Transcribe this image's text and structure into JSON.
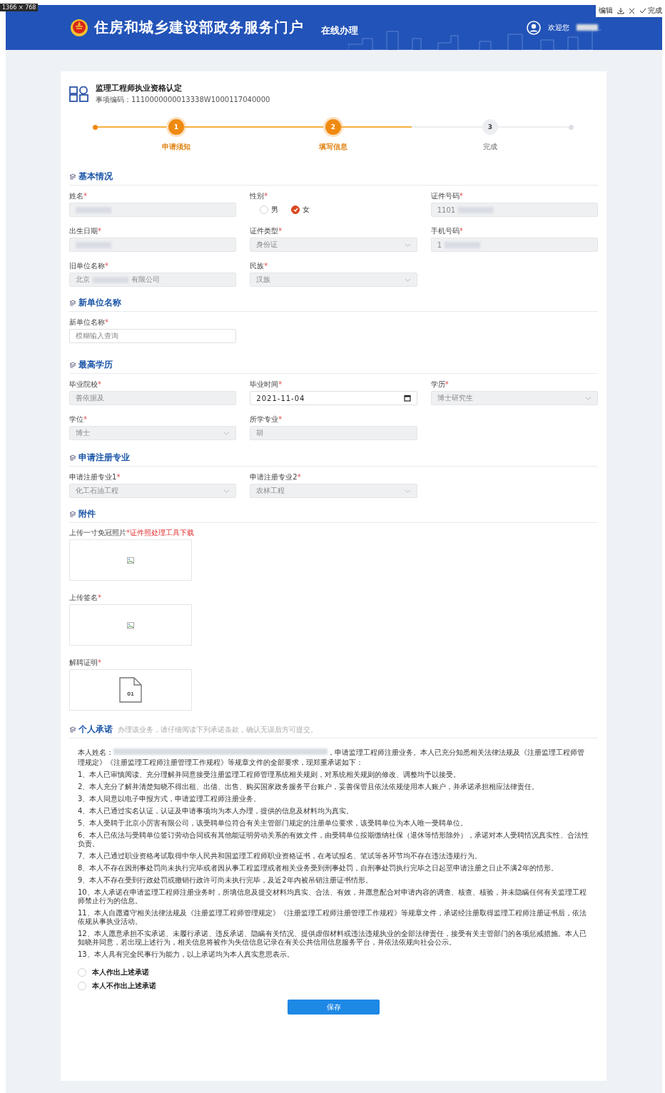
{
  "capture_size": "1366 × 768",
  "capture_toolbar": {
    "edit": "编辑",
    "done": "完成"
  },
  "header": {
    "title": "住房和城乡建设部政务服务门户",
    "subtitle": "在线办理",
    "welcome": "欢迎您"
  },
  "service": {
    "title": "监理工程师执业资格认定",
    "code_label": "事项编码：",
    "code": "1110000000013338W1000117040000"
  },
  "steps": [
    {
      "number": "1",
      "label": "申请须知",
      "done": true
    },
    {
      "number": "2",
      "label": "填写信息",
      "done": true
    },
    {
      "number": "3",
      "label": "完成",
      "done": false
    }
  ],
  "connectors": [
    {
      "done": true
    },
    {
      "done": true
    },
    {
      "done": true
    },
    {
      "done": false
    },
    {
      "done": false
    }
  ],
  "required_mark": "*",
  "sections": [
    {
      "kind": "fields",
      "title": "基本情况",
      "fields": [
        {
          "kind": "text",
          "label": "姓名",
          "required": true,
          "redacted": true,
          "disabled": true
        },
        {
          "kind": "radio",
          "label": "性别",
          "required": true,
          "options": [
            {
              "label": "男",
              "selected": false
            },
            {
              "label": "女",
              "selected": true
            }
          ]
        },
        {
          "kind": "text",
          "label": "证件号码",
          "required": true,
          "value": "1101",
          "redacted": true,
          "disabled": true
        },
        {
          "kind": "text",
          "label": "出生日期",
          "required": true,
          "redacted": true,
          "disabled": true
        },
        {
          "kind": "select",
          "label": "证件类型",
          "required": true,
          "value": "身份证",
          "disabled": true
        },
        {
          "kind": "text",
          "label": "手机号码",
          "required": true,
          "value": "1",
          "redacted": true,
          "disabled": true
        },
        {
          "kind": "text",
          "label": "旧单位名称",
          "required": true,
          "value": "北京",
          "redacted": true,
          "value_end": "有限公司",
          "disabled": true
        },
        {
          "kind": "select",
          "label": "民族",
          "required": true,
          "value": "汉族",
          "disabled": true
        }
      ]
    },
    {
      "kind": "fields",
      "title": "新单位名称",
      "fields": [
        {
          "kind": "text",
          "label": "新单位名称",
          "required": true,
          "placeholder": "模糊输入查询",
          "disabled": false
        }
      ]
    },
    {
      "kind": "fields",
      "title": "最高学历",
      "fields": [
        {
          "kind": "text",
          "label": "毕业院校",
          "required": true,
          "value": "善依据及",
          "disabled": true
        },
        {
          "kind": "date",
          "label": "毕业时间",
          "required": true,
          "value": "2021-11-04",
          "disabled": false
        },
        {
          "kind": "select",
          "label": "学历",
          "required": true,
          "value": "博士研究生",
          "disabled": true
        },
        {
          "kind": "select",
          "label": "学位",
          "required": true,
          "value": "博士",
          "disabled": true
        },
        {
          "kind": "text",
          "label": "所学专业",
          "required": true,
          "value": "胡",
          "disabled": true
        }
      ]
    },
    {
      "kind": "fields",
      "title": "申请注册专业",
      "fields": [
        {
          "kind": "select",
          "label": "申请注册专业1",
          "required": true,
          "value": "化工石油工程",
          "disabled": true
        },
        {
          "kind": "select",
          "label": "申请注册专业2",
          "required": true,
          "value": "农林工程",
          "disabled": true
        }
      ]
    },
    {
      "kind": "uploads",
      "title": "附件",
      "uploads": [
        {
          "kind": "image",
          "label": "上传一寸免冠照片",
          "required": true,
          "link": "证件照处理工具下载"
        },
        {
          "kind": "image",
          "label": "上传签名",
          "required": true
        },
        {
          "kind": "file",
          "label": "解聘证明",
          "required": true,
          "file_label": "01"
        }
      ]
    }
  ],
  "commitment": {
    "title": "个人承诺",
    "hint": "办理该业务，请仔细阅读下列承诺条款，确认无误后方可提交。",
    "intro_start": "本人姓名：",
    "intro_end": "，申请监理工程师注册业务。本人已充分知悉相关法律法规及《注册监理工程师管理规定》《注册监理工程师注册管理工作规程》等规章文件的全部要求，现郑重承诺如下：",
    "items": [
      "1、本人已审慎阅读、充分理解并同意接受注册监理工程师管理系统相关规则，对系统相关规则的修改、调整均予以接受。",
      "2、本人充分了解并清楚知晓不得出租、出借、出售、购买国家政务服务平台账户，妥善保管且依法依规使用本人账户，并承诺承担相应法律责任。",
      "3、本人同意以电子申报方式，申请监理工程师注册业务。",
      "4、本人已通过实名认证，认证及申请事项均为本人办理，提供的信息及材料均为真实。",
      "5、本人受聘于北京小厉害有限公司，该受聘单位符合有关主管部门规定的注册单位要求，该受聘单位为本人唯一受聘单位。",
      "6、本人已依法与受聘单位签订劳动合同或有其他能证明劳动关系的有效文件，由受聘单位按期缴纳社保（退休等情形除外），承诺对本人受聘情况真实性、合法性负责。",
      "7、本人已通过职业资格考试取得中华人民共和国监理工程师职业资格证书，在考试报名、笔试等各环节均不存在违法违规行为。",
      "8、本人不存在因刑事处罚尚未执行完毕或者因从事工程监理或者相关业务受到刑事处罚，自刑事处罚执行完毕之日起至申请注册之日止不满2年的情形。",
      "9、本人不存在受到行政处罚或撤销行政许可尚未执行完毕，及近2年内被吊销注册证书情形。",
      "10、本人承诺在申请监理工程师注册业务时，所填信息及提交材料均真实、合法、有效，并愿意配合对申请内容的调查、核查、核验，并未隐瞒任何有关监理工程师禁止行为的信息。",
      "11、本人自愿遵守相关法律法规及《注册监理工程师管理规定》《注册监理工程师注册管理工作规程》等规章文件，承诺经注册取得监理工程师注册证书后，依法依规从事执业活动。",
      "12、本人愿意承担不实承诺、未履行承诺、违反承诺、隐瞒有关情况、提供虚假材料或违法违规执业的全部法律责任，接受有关主管部门的各项惩戒措施。本人已知晓并同意，若出现上述行为，相关信息将被作为失信信息记录在有关公共信用信息服务平台，并依法依规向社会公示。",
      "13、本人具有完全民事行为能力，以上承诺均为本人真实意思表示。"
    ],
    "choices": [
      {
        "label": "本人作出上述承诺",
        "selected": false
      },
      {
        "label": "本人不作出上述承诺",
        "selected": false
      }
    ],
    "save": "保存"
  }
}
